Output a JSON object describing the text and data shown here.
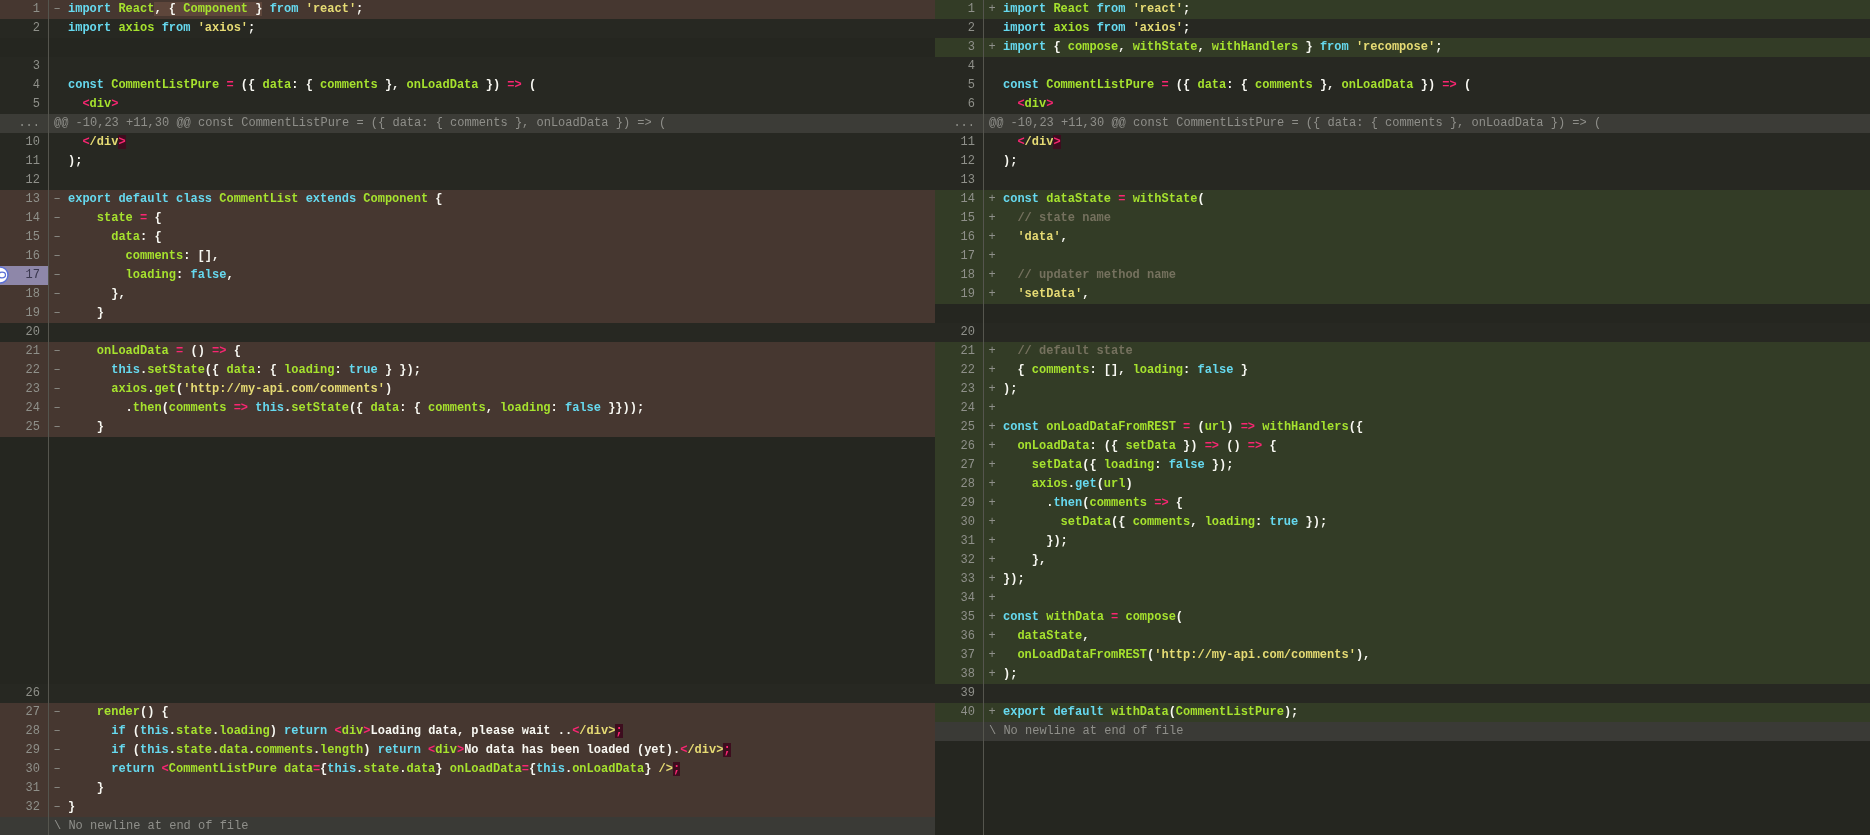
{
  "panes": [
    {
      "lines": [
        {
          "kind": "removed",
          "number": "1",
          "marker": "–",
          "selected": false,
          "tokens": [
            {
              "kind": "keyword",
              "text": "import"
            },
            {
              "kind": "name",
              "text": " React"
            },
            {
              "kind": "changed",
              "tokens": [
                {
                  "kind": "plain",
                  "text": ", { "
                },
                {
                  "kind": "name",
                  "text": "Component"
                },
                {
                  "kind": "plain",
                  "text": " }"
                }
              ]
            },
            {
              "kind": "keyword",
              "text": " from"
            },
            {
              "kind": "string",
              "text": " 'react'"
            },
            {
              "kind": "plain",
              "text": ";"
            }
          ]
        },
        {
          "kind": "context",
          "number": "2",
          "selected": false,
          "tokens": [
            {
              "kind": "keyword",
              "text": "import"
            },
            {
              "kind": "name",
              "text": " axios"
            },
            {
              "kind": "keyword",
              "text": " from"
            },
            {
              "kind": "string",
              "text": " 'axios'"
            },
            {
              "kind": "plain",
              "text": ";"
            }
          ]
        },
        {
          "kind": "filler",
          "selected": false
        },
        {
          "kind": "context",
          "number": "3",
          "selected": false
        },
        {
          "kind": "context",
          "number": "4",
          "selected": false,
          "tokens": [
            {
              "kind": "keyword",
              "text": "const"
            },
            {
              "kind": "name",
              "text": " CommentListPure"
            },
            {
              "kind": "operator",
              "text": " ="
            },
            {
              "kind": "plain",
              "text": " ({"
            },
            {
              "kind": "name",
              "text": " data"
            },
            {
              "kind": "plain",
              "text": ": {"
            },
            {
              "kind": "name",
              "text": " comments"
            },
            {
              "kind": "plain",
              "text": " },"
            },
            {
              "kind": "name",
              "text": " onLoadData"
            },
            {
              "kind": "plain",
              "text": " })"
            },
            {
              "kind": "operator",
              "text": " =>"
            },
            {
              "kind": "plain",
              "text": " ("
            }
          ]
        },
        {
          "kind": "context",
          "number": "5",
          "selected": false,
          "tokens": [
            {
              "kind": "operator",
              "text": "  <"
            },
            {
              "kind": "name",
              "text": "div"
            },
            {
              "kind": "operator",
              "text": ">"
            }
          ]
        },
        {
          "kind": "hunk",
          "number": "...",
          "selected": false,
          "text": "@@ -10,23 +11,30 @@ const CommentListPure = ({ data: { comments }, onLoadData }) => ("
        },
        {
          "kind": "context",
          "number": "10",
          "selected": false,
          "tokens": [
            {
              "kind": "operator",
              "text": "  <"
            },
            {
              "kind": "string",
              "text": "/div"
            },
            {
              "kind": "invalid",
              "text": ">"
            }
          ]
        },
        {
          "kind": "context",
          "number": "11",
          "selected": false,
          "tokens": [
            {
              "kind": "plain",
              "text": ");"
            }
          ]
        },
        {
          "kind": "context",
          "number": "12",
          "selected": false
        },
        {
          "kind": "removed",
          "number": "13",
          "marker": "–",
          "selected": false,
          "tokens": [
            {
              "kind": "keyword",
              "text": "export"
            },
            {
              "kind": "keyword",
              "text": " default"
            },
            {
              "kind": "keyword",
              "text": " class"
            },
            {
              "kind": "name",
              "text": " CommentList"
            },
            {
              "kind": "keyword",
              "text": " extends"
            },
            {
              "kind": "name",
              "text": " Component"
            },
            {
              "kind": "plain",
              "text": " {"
            }
          ]
        },
        {
          "kind": "removed",
          "number": "14",
          "marker": "–",
          "selected": false,
          "tokens": [
            {
              "kind": "name",
              "text": "    state"
            },
            {
              "kind": "operator",
              "text": " ="
            },
            {
              "kind": "plain",
              "text": " {"
            }
          ]
        },
        {
          "kind": "removed",
          "number": "15",
          "marker": "–",
          "selected": false,
          "tokens": [
            {
              "kind": "name",
              "text": "      data"
            },
            {
              "kind": "plain",
              "text": ": {"
            }
          ]
        },
        {
          "kind": "removed",
          "number": "16",
          "marker": "–",
          "selected": false,
          "tokens": [
            {
              "kind": "name",
              "text": "        comments"
            },
            {
              "kind": "plain",
              "text": ": [],"
            }
          ]
        },
        {
          "kind": "removed",
          "number": "17",
          "marker": "–",
          "selected": true,
          "tokens": [
            {
              "kind": "name",
              "text": "        loading"
            },
            {
              "kind": "plain",
              "text": ":"
            },
            {
              "kind": "keyword",
              "text": " false"
            },
            {
              "kind": "plain",
              "text": ","
            }
          ]
        },
        {
          "kind": "removed",
          "number": "18",
          "marker": "–",
          "selected": false,
          "tokens": [
            {
              "kind": "plain",
              "text": "      },"
            }
          ]
        },
        {
          "kind": "removed",
          "number": "19",
          "marker": "–",
          "selected": false,
          "tokens": [
            {
              "kind": "plain",
              "text": "    }"
            }
          ]
        },
        {
          "kind": "context",
          "number": "20",
          "selected": false
        },
        {
          "kind": "removed",
          "number": "21",
          "marker": "–",
          "selected": false,
          "tokens": [
            {
              "kind": "name",
              "text": "    onLoadData"
            },
            {
              "kind": "operator",
              "text": " ="
            },
            {
              "kind": "plain",
              "text": " ()"
            },
            {
              "kind": "operator",
              "text": " =>"
            },
            {
              "kind": "plain",
              "text": " {"
            }
          ]
        },
        {
          "kind": "removed",
          "number": "22",
          "marker": "–",
          "selected": false,
          "tokens": [
            {
              "kind": "keyword",
              "text": "      this"
            },
            {
              "kind": "plain",
              "text": "."
            },
            {
              "kind": "name",
              "text": "setState"
            },
            {
              "kind": "plain",
              "text": "({"
            },
            {
              "kind": "name",
              "text": " data"
            },
            {
              "kind": "plain",
              "text": ": {"
            },
            {
              "kind": "name",
              "text": " loading"
            },
            {
              "kind": "plain",
              "text": ":"
            },
            {
              "kind": "keyword",
              "text": " true"
            },
            {
              "kind": "plain",
              "text": " } });"
            }
          ]
        },
        {
          "kind": "removed",
          "number": "23",
          "marker": "–",
          "selected": false,
          "tokens": [
            {
              "kind": "name",
              "text": "      axios"
            },
            {
              "kind": "plain",
              "text": "."
            },
            {
              "kind": "name",
              "text": "get"
            },
            {
              "kind": "plain",
              "text": "("
            },
            {
              "kind": "string",
              "text": "'http://my-api.com/comments'"
            },
            {
              "kind": "plain",
              "text": ")"
            }
          ]
        },
        {
          "kind": "removed",
          "number": "24",
          "marker": "–",
          "selected": false,
          "tokens": [
            {
              "kind": "plain",
              "text": "        ."
            },
            {
              "kind": "name",
              "text": "then"
            },
            {
              "kind": "plain",
              "text": "("
            },
            {
              "kind": "name",
              "text": "comments"
            },
            {
              "kind": "operator",
              "text": " =>"
            },
            {
              "kind": "keyword",
              "text": " this"
            },
            {
              "kind": "plain",
              "text": "."
            },
            {
              "kind": "name",
              "text": "setState"
            },
            {
              "kind": "plain",
              "text": "({"
            },
            {
              "kind": "name",
              "text": " data"
            },
            {
              "kind": "plain",
              "text": ": {"
            },
            {
              "kind": "name",
              "text": " comments"
            },
            {
              "kind": "plain",
              "text": ","
            },
            {
              "kind": "name",
              "text": " loading"
            },
            {
              "kind": "plain",
              "text": ":"
            },
            {
              "kind": "keyword",
              "text": " false"
            },
            {
              "kind": "plain",
              "text": " }}));"
            }
          ]
        },
        {
          "kind": "removed",
          "number": "25",
          "marker": "–",
          "selected": false,
          "tokens": [
            {
              "kind": "plain",
              "text": "    }"
            }
          ]
        },
        {
          "kind": "filler",
          "selected": false
        },
        {
          "kind": "filler",
          "selected": false
        },
        {
          "kind": "filler",
          "selected": false
        },
        {
          "kind": "filler",
          "selected": false
        },
        {
          "kind": "filler",
          "selected": false
        },
        {
          "kind": "filler",
          "selected": false
        },
        {
          "kind": "filler",
          "selected": false
        },
        {
          "kind": "filler",
          "selected": false
        },
        {
          "kind": "filler",
          "selected": false
        },
        {
          "kind": "filler",
          "selected": false
        },
        {
          "kind": "filler",
          "selected": false
        },
        {
          "kind": "filler",
          "selected": false
        },
        {
          "kind": "filler",
          "selected": false
        },
        {
          "kind": "context",
          "number": "26",
          "selected": false
        },
        {
          "kind": "removed",
          "number": "27",
          "marker": "–",
          "selected": false,
          "tokens": [
            {
              "kind": "name",
              "text": "    render"
            },
            {
              "kind": "plain",
              "text": "() {"
            }
          ]
        },
        {
          "kind": "removed",
          "number": "28",
          "marker": "–",
          "selected": false,
          "tokens": [
            {
              "kind": "keyword",
              "text": "      if"
            },
            {
              "kind": "plain",
              "text": " ("
            },
            {
              "kind": "keyword",
              "text": "this"
            },
            {
              "kind": "plain",
              "text": "."
            },
            {
              "kind": "name",
              "text": "state"
            },
            {
              "kind": "plain",
              "text": "."
            },
            {
              "kind": "name",
              "text": "loading"
            },
            {
              "kind": "plain",
              "text": ")"
            },
            {
              "kind": "keyword",
              "text": " return"
            },
            {
              "kind": "operator",
              "text": " <"
            },
            {
              "kind": "name",
              "text": "div"
            },
            {
              "kind": "operator",
              "text": ">"
            },
            {
              "kind": "plain",
              "text": "Loading data, please wait .."
            },
            {
              "kind": "operator",
              "text": "<"
            },
            {
              "kind": "string",
              "text": "/div>"
            },
            {
              "kind": "invalid",
              "text": ";"
            }
          ]
        },
        {
          "kind": "removed",
          "number": "29",
          "marker": "–",
          "selected": false,
          "tokens": [
            {
              "kind": "keyword",
              "text": "      if"
            },
            {
              "kind": "plain",
              "text": " ("
            },
            {
              "kind": "keyword",
              "text": "this"
            },
            {
              "kind": "plain",
              "text": "."
            },
            {
              "kind": "name",
              "text": "state"
            },
            {
              "kind": "plain",
              "text": "."
            },
            {
              "kind": "name",
              "text": "data"
            },
            {
              "kind": "plain",
              "text": "."
            },
            {
              "kind": "name",
              "text": "comments"
            },
            {
              "kind": "plain",
              "text": "."
            },
            {
              "kind": "name",
              "text": "length"
            },
            {
              "kind": "plain",
              "text": ")"
            },
            {
              "kind": "keyword",
              "text": " return"
            },
            {
              "kind": "operator",
              "text": " <"
            },
            {
              "kind": "name",
              "text": "div"
            },
            {
              "kind": "operator",
              "text": ">"
            },
            {
              "kind": "plain",
              "text": "No data has been loaded (yet)."
            },
            {
              "kind": "operator",
              "text": "<"
            },
            {
              "kind": "string",
              "text": "/div>"
            },
            {
              "kind": "invalid",
              "text": ";"
            }
          ]
        },
        {
          "kind": "removed",
          "number": "30",
          "marker": "–",
          "selected": false,
          "tokens": [
            {
              "kind": "keyword",
              "text": "      return"
            },
            {
              "kind": "operator",
              "text": " <"
            },
            {
              "kind": "name",
              "text": "CommentListPure"
            },
            {
              "kind": "name",
              "text": " data"
            },
            {
              "kind": "operator",
              "text": "="
            },
            {
              "kind": "plain",
              "text": "{"
            },
            {
              "kind": "keyword",
              "text": "this"
            },
            {
              "kind": "plain",
              "text": "."
            },
            {
              "kind": "name",
              "text": "state"
            },
            {
              "kind": "plain",
              "text": "."
            },
            {
              "kind": "name",
              "text": "data"
            },
            {
              "kind": "plain",
              "text": "}"
            },
            {
              "kind": "name",
              "text": " onLoadData"
            },
            {
              "kind": "operator",
              "text": "="
            },
            {
              "kind": "plain",
              "text": "{"
            },
            {
              "kind": "keyword",
              "text": "this"
            },
            {
              "kind": "plain",
              "text": "."
            },
            {
              "kind": "name",
              "text": "onLoadData"
            },
            {
              "kind": "plain",
              "text": "}"
            },
            {
              "kind": "string",
              "text": " />"
            },
            {
              "kind": "invalid",
              "text": ";"
            }
          ]
        },
        {
          "kind": "removed",
          "number": "31",
          "marker": "–",
          "selected": false,
          "tokens": [
            {
              "kind": "plain",
              "text": "    }"
            }
          ]
        },
        {
          "kind": "removed",
          "number": "32",
          "marker": "–",
          "selected": false,
          "tokens": [
            {
              "kind": "plain",
              "text": "}"
            }
          ]
        },
        {
          "kind": "note",
          "selected": false,
          "text": "\\ No newline at end of file"
        }
      ]
    },
    {
      "lines": [
        {
          "kind": "added",
          "number": "1",
          "marker": "+",
          "selected": false,
          "tokens": [
            {
              "kind": "keyword",
              "text": "import"
            },
            {
              "kind": "name",
              "text": " React"
            },
            {
              "kind": "keyword",
              "text": " from"
            },
            {
              "kind": "string",
              "text": " 'react'"
            },
            {
              "kind": "plain",
              "text": ";"
            }
          ]
        },
        {
          "kind": "context",
          "number": "2",
          "selected": false,
          "tokens": [
            {
              "kind": "keyword",
              "text": "import"
            },
            {
              "kind": "name",
              "text": " axios"
            },
            {
              "kind": "keyword",
              "text": " from"
            },
            {
              "kind": "string",
              "text": " 'axios'"
            },
            {
              "kind": "plain",
              "text": ";"
            }
          ]
        },
        {
          "kind": "added",
          "number": "3",
          "marker": "+",
          "selected": false,
          "tokens": [
            {
              "kind": "keyword",
              "text": "import"
            },
            {
              "kind": "plain",
              "text": " {"
            },
            {
              "kind": "name",
              "text": " compose"
            },
            {
              "kind": "plain",
              "text": ","
            },
            {
              "kind": "name",
              "text": " withState"
            },
            {
              "kind": "plain",
              "text": ","
            },
            {
              "kind": "name",
              "text": " withHandlers"
            },
            {
              "kind": "plain",
              "text": " }"
            },
            {
              "kind": "keyword",
              "text": " from"
            },
            {
              "kind": "string",
              "text": " 'recompose'"
            },
            {
              "kind": "plain",
              "text": ";"
            }
          ]
        },
        {
          "kind": "context",
          "number": "4",
          "selected": false
        },
        {
          "kind": "context",
          "number": "5",
          "selected": false,
          "tokens": [
            {
              "kind": "keyword",
              "text": "const"
            },
            {
              "kind": "name",
              "text": " CommentListPure"
            },
            {
              "kind": "operator",
              "text": " ="
            },
            {
              "kind": "plain",
              "text": " ({"
            },
            {
              "kind": "name",
              "text": " data"
            },
            {
              "kind": "plain",
              "text": ": {"
            },
            {
              "kind": "name",
              "text": " comments"
            },
            {
              "kind": "plain",
              "text": " },"
            },
            {
              "kind": "name",
              "text": " onLoadData"
            },
            {
              "kind": "plain",
              "text": " })"
            },
            {
              "kind": "operator",
              "text": " =>"
            },
            {
              "kind": "plain",
              "text": " ("
            }
          ]
        },
        {
          "kind": "context",
          "number": "6",
          "selected": false,
          "tokens": [
            {
              "kind": "operator",
              "text": "  <"
            },
            {
              "kind": "name",
              "text": "div"
            },
            {
              "kind": "operator",
              "text": ">"
            }
          ]
        },
        {
          "kind": "hunk",
          "number": "...",
          "selected": false,
          "text": "@@ -10,23 +11,30 @@ const CommentListPure = ({ data: { comments }, onLoadData }) => ("
        },
        {
          "kind": "context",
          "number": "11",
          "selected": false,
          "tokens": [
            {
              "kind": "operator",
              "text": "  <"
            },
            {
              "kind": "string",
              "text": "/div"
            },
            {
              "kind": "invalid",
              "text": ">"
            }
          ]
        },
        {
          "kind": "context",
          "number": "12",
          "selected": false,
          "tokens": [
            {
              "kind": "plain",
              "text": ");"
            }
          ]
        },
        {
          "kind": "context",
          "number": "13",
          "selected": false
        },
        {
          "kind": "added",
          "number": "14",
          "marker": "+",
          "selected": false,
          "tokens": [
            {
              "kind": "keyword",
              "text": "const"
            },
            {
              "kind": "name",
              "text": " dataState"
            },
            {
              "kind": "operator",
              "text": " ="
            },
            {
              "kind": "name",
              "text": " withState"
            },
            {
              "kind": "plain",
              "text": "("
            }
          ]
        },
        {
          "kind": "added",
          "number": "15",
          "marker": "+",
          "selected": false,
          "tokens": [
            {
              "kind": "comment",
              "text": "  // state name"
            }
          ]
        },
        {
          "kind": "added",
          "number": "16",
          "marker": "+",
          "selected": false,
          "tokens": [
            {
              "kind": "string",
              "text": "  'data'"
            },
            {
              "kind": "plain",
              "text": ","
            }
          ]
        },
        {
          "kind": "added",
          "number": "17",
          "marker": "+",
          "selected": false
        },
        {
          "kind": "added",
          "number": "18",
          "marker": "+",
          "selected": false,
          "tokens": [
            {
              "kind": "comment",
              "text": "  // updater method name"
            }
          ]
        },
        {
          "kind": "added",
          "number": "19",
          "marker": "+",
          "selected": false,
          "tokens": [
            {
              "kind": "string",
              "text": "  'setData'"
            },
            {
              "kind": "plain",
              "text": ","
            }
          ]
        },
        {
          "kind": "filler",
          "selected": false
        },
        {
          "kind": "context",
          "number": "20",
          "selected": false
        },
        {
          "kind": "added",
          "number": "21",
          "marker": "+",
          "selected": false,
          "tokens": [
            {
              "kind": "comment",
              "text": "  // default state"
            }
          ]
        },
        {
          "kind": "added",
          "number": "22",
          "marker": "+",
          "selected": false,
          "tokens": [
            {
              "kind": "plain",
              "text": "  {"
            },
            {
              "kind": "name",
              "text": " comments"
            },
            {
              "kind": "plain",
              "text": ": [],"
            },
            {
              "kind": "name",
              "text": " loading"
            },
            {
              "kind": "plain",
              "text": ":"
            },
            {
              "kind": "keyword",
              "text": " false"
            },
            {
              "kind": "plain",
              "text": " }"
            }
          ]
        },
        {
          "kind": "added",
          "number": "23",
          "marker": "+",
          "selected": false,
          "tokens": [
            {
              "kind": "plain",
              "text": ");"
            }
          ]
        },
        {
          "kind": "added",
          "number": "24",
          "marker": "+",
          "selected": false
        },
        {
          "kind": "added",
          "number": "25",
          "marker": "+",
          "selected": false,
          "tokens": [
            {
              "kind": "keyword",
              "text": "const"
            },
            {
              "kind": "name",
              "text": " onLoadDataFromREST"
            },
            {
              "kind": "operator",
              "text": " ="
            },
            {
              "kind": "plain",
              "text": " ("
            },
            {
              "kind": "name",
              "text": "url"
            },
            {
              "kind": "plain",
              "text": ")"
            },
            {
              "kind": "operator",
              "text": " =>"
            },
            {
              "kind": "name",
              "text": " withHandlers"
            },
            {
              "kind": "plain",
              "text": "({"
            }
          ]
        },
        {
          "kind": "added",
          "number": "26",
          "marker": "+",
          "selected": false,
          "tokens": [
            {
              "kind": "name",
              "text": "  onLoadData"
            },
            {
              "kind": "plain",
              "text": ": ({"
            },
            {
              "kind": "name",
              "text": " setData"
            },
            {
              "kind": "plain",
              "text": " })"
            },
            {
              "kind": "operator",
              "text": " =>"
            },
            {
              "kind": "plain",
              "text": " ()"
            },
            {
              "kind": "operator",
              "text": " =>"
            },
            {
              "kind": "plain",
              "text": " {"
            }
          ]
        },
        {
          "kind": "added",
          "number": "27",
          "marker": "+",
          "selected": false,
          "tokens": [
            {
              "kind": "name",
              "text": "    setData"
            },
            {
              "kind": "plain",
              "text": "({"
            },
            {
              "kind": "name",
              "text": " loading"
            },
            {
              "kind": "plain",
              "text": ":"
            },
            {
              "kind": "keyword",
              "text": " false"
            },
            {
              "kind": "plain",
              "text": " });"
            }
          ]
        },
        {
          "kind": "added",
          "number": "28",
          "marker": "+",
          "selected": false,
          "tokens": [
            {
              "kind": "name",
              "text": "    axios"
            },
            {
              "kind": "plain",
              "text": "."
            },
            {
              "kind": "keyword",
              "text": "get"
            },
            {
              "kind": "plain",
              "text": "("
            },
            {
              "kind": "name",
              "text": "url"
            },
            {
              "kind": "plain",
              "text": ")"
            }
          ]
        },
        {
          "kind": "added",
          "number": "29",
          "marker": "+",
          "selected": false,
          "tokens": [
            {
              "kind": "plain",
              "text": "      ."
            },
            {
              "kind": "keyword",
              "text": "then"
            },
            {
              "kind": "plain",
              "text": "("
            },
            {
              "kind": "name",
              "text": "comments"
            },
            {
              "kind": "operator",
              "text": " =>"
            },
            {
              "kind": "plain",
              "text": " {"
            }
          ]
        },
        {
          "kind": "added",
          "number": "30",
          "marker": "+",
          "selected": false,
          "tokens": [
            {
              "kind": "name",
              "text": "        setData"
            },
            {
              "kind": "plain",
              "text": "({"
            },
            {
              "kind": "name",
              "text": " comments"
            },
            {
              "kind": "plain",
              "text": ","
            },
            {
              "kind": "name",
              "text": " loading"
            },
            {
              "kind": "plain",
              "text": ":"
            },
            {
              "kind": "keyword",
              "text": " true"
            },
            {
              "kind": "plain",
              "text": " });"
            }
          ]
        },
        {
          "kind": "added",
          "number": "31",
          "marker": "+",
          "selected": false,
          "tokens": [
            {
              "kind": "plain",
              "text": "      });"
            }
          ]
        },
        {
          "kind": "added",
          "number": "32",
          "marker": "+",
          "selected": false,
          "tokens": [
            {
              "kind": "plain",
              "text": "    },"
            }
          ]
        },
        {
          "kind": "added",
          "number": "33",
          "marker": "+",
          "selected": false,
          "tokens": [
            {
              "kind": "plain",
              "text": "});"
            }
          ]
        },
        {
          "kind": "added",
          "number": "34",
          "marker": "+",
          "selected": false
        },
        {
          "kind": "added",
          "number": "35",
          "marker": "+",
          "selected": false,
          "tokens": [
            {
              "kind": "keyword",
              "text": "const"
            },
            {
              "kind": "name",
              "text": " withData"
            },
            {
              "kind": "operator",
              "text": " ="
            },
            {
              "kind": "name",
              "text": " compose"
            },
            {
              "kind": "plain",
              "text": "("
            }
          ]
        },
        {
          "kind": "added",
          "number": "36",
          "marker": "+",
          "selected": false,
          "tokens": [
            {
              "kind": "name",
              "text": "  dataState"
            },
            {
              "kind": "plain",
              "text": ","
            }
          ]
        },
        {
          "kind": "added",
          "number": "37",
          "marker": "+",
          "selected": false,
          "tokens": [
            {
              "kind": "name",
              "text": "  onLoadDataFromREST"
            },
            {
              "kind": "plain",
              "text": "("
            },
            {
              "kind": "string",
              "text": "'http://my-api.com/comments'"
            },
            {
              "kind": "plain",
              "text": "),"
            }
          ]
        },
        {
          "kind": "added",
          "number": "38",
          "marker": "+",
          "selected": false,
          "tokens": [
            {
              "kind": "plain",
              "text": ");"
            }
          ]
        },
        {
          "kind": "context",
          "number": "39",
          "selected": false
        },
        {
          "kind": "added",
          "number": "40",
          "marker": "+",
          "selected": false,
          "tokens": [
            {
              "kind": "keyword",
              "text": "export"
            },
            {
              "kind": "keyword",
              "text": " default"
            },
            {
              "kind": "name",
              "text": " withData"
            },
            {
              "kind": "plain",
              "text": "("
            },
            {
              "kind": "name",
              "text": "CommentListPure"
            },
            {
              "kind": "plain",
              "text": ");"
            }
          ]
        },
        {
          "kind": "note",
          "selected": false,
          "text": "\\ No newline at end of file"
        },
        {
          "kind": "filler",
          "selected": false
        },
        {
          "kind": "filler",
          "selected": false
        },
        {
          "kind": "filler",
          "selected": false
        },
        {
          "kind": "filler",
          "selected": false
        },
        {
          "kind": "filler",
          "selected": false
        }
      ]
    }
  ]
}
